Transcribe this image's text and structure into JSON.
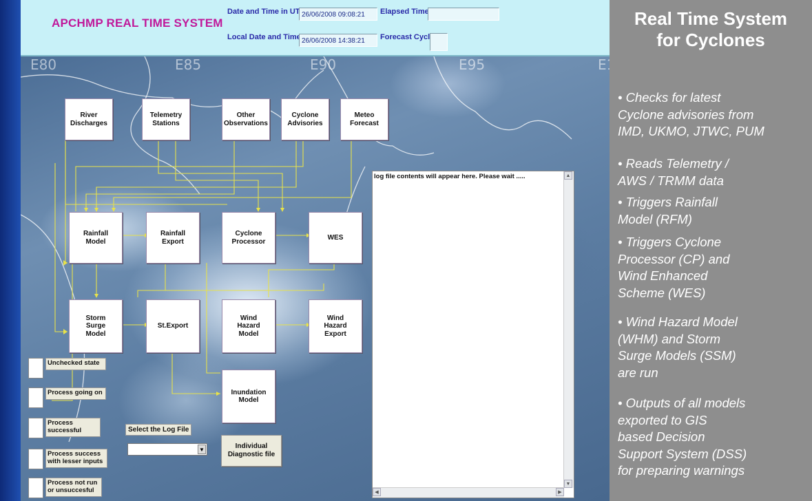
{
  "app": {
    "title": "APCHMP REAL TIME SYSTEM",
    "utc_label": "Date and Time in UTC",
    "utc_value": "26/06/2008 09:08:21",
    "local_label": "Local Date and Time",
    "local_value": "26/06/2008 14:38:21",
    "elapsed_label": "Elapsed Time",
    "elapsed_value": "",
    "forecast_label": "Forecast Cycle",
    "forecast_value": ""
  },
  "map_labels": [
    "E80",
    "E85",
    "E90",
    "E95",
    "E1"
  ],
  "boxes": {
    "river": "River\nDischarges",
    "telemetry": "Telemetry\nStations",
    "other_obs": "Other\nObservations",
    "cyclone_adv": "Cyclone\nAdvisories",
    "meteo": "Meteo\nForecast",
    "rainfall_model": "Rainfall\nModel",
    "rainfall_export": "Rainfall\nExport",
    "cyclone_proc": "Cyclone\nProcessor",
    "wes": "WES",
    "storm_surge": "Storm\nSurge\nModel",
    "st_export": "St.Export",
    "wind_hazard": "Wind\nHazard\nModel",
    "wind_hazard_export": "Wind\nHazard\nExport",
    "inundation": "Inundation\nModel"
  },
  "legend": [
    "Unchecked state",
    "Process going on",
    "Process\nsuccessful",
    "Process success\nwith lesser inputs",
    "Process not run\nor unsuccesful"
  ],
  "log": {
    "text": "log file contents will appear here. Please wait .....",
    "select_label": "Select the Log File",
    "select_value": "",
    "diag_button": "Individual\nDiagnostic file"
  },
  "sidebar": {
    "title": "Real Time System\nfor Cyclones",
    "bullets": [
      "• Checks for latest\nCyclone   advisories from\nIMD, UKMO, JTWC, PUM",
      "•  Reads Telemetry /\n    AWS / TRMM data",
      "•  Triggers Rainfall\n     Model (RFM)",
      "•  Triggers Cyclone\n     Processor (CP) and\n     Wind Enhanced\n     Scheme (WES)",
      "•    Wind Hazard Model\n      (WHM) and Storm\n      Surge Models (SSM)\n      are run",
      "•    Outputs of all models\n       exported to GIS\n       based Decision\n       Support System (DSS)\n       for preparing warnings"
    ]
  },
  "colors": {
    "wire": "#e8e24a",
    "title": "#c0189a",
    "sidebar_bg": "#8e8e8e"
  }
}
